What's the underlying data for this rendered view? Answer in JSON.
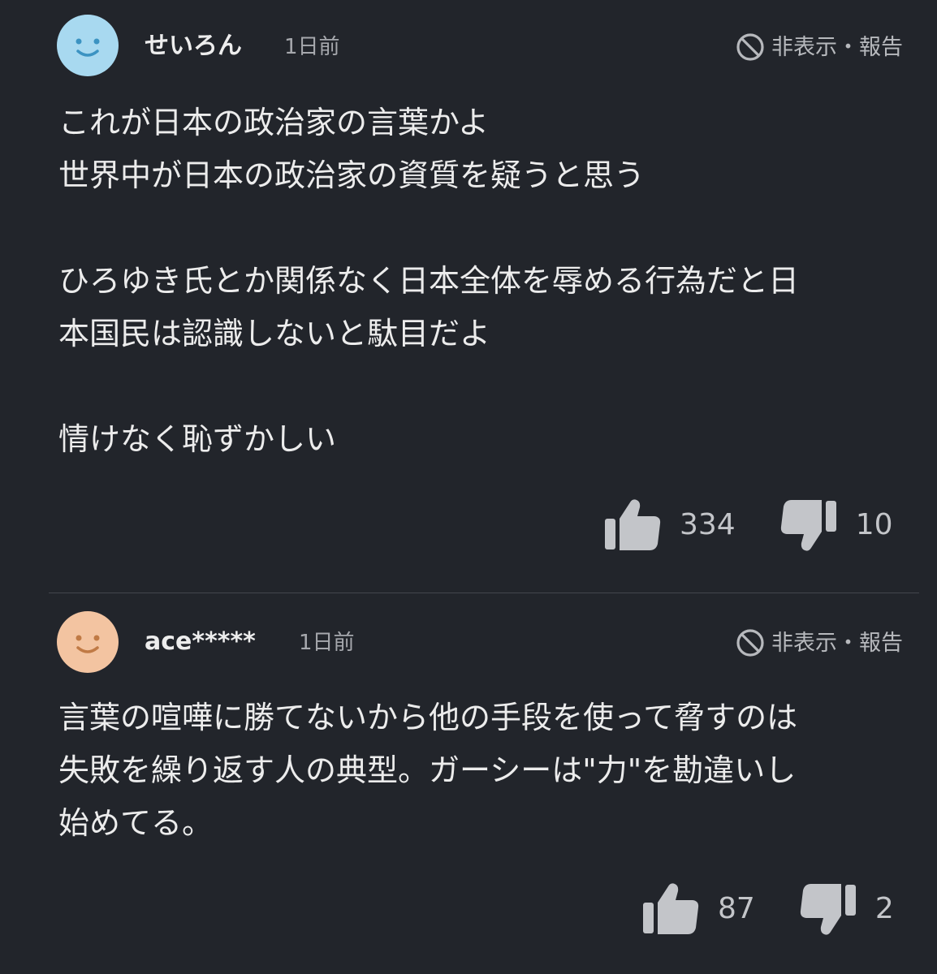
{
  "colors": {
    "background": "#22252b",
    "avatar_blue": "#a8d9f0",
    "avatar_peach": "#f3c4a1"
  },
  "comments": [
    {
      "username": "せいろん",
      "timestamp": "1日前",
      "avatar_icon": "smiley-face-icon",
      "hide_report": "非表示・報告",
      "body": "これが日本の政治家の言葉かよ\n世界中が日本の政治家の資質を疑うと思う\n\nひろゆき氏とか関係なく日本全体を辱める行為だと日\n本国民は認識しないと駄目だよ\n\n情けなく恥ずかしい",
      "likes": "334",
      "dislikes": "10"
    },
    {
      "username": "ace*****",
      "timestamp": "1日前",
      "avatar_icon": "smiley-face-icon",
      "hide_report": "非表示・報告",
      "body": "言葉の喧嘩に勝てないから他の手段を使って脅すのは\n失敗を繰り返す人の典型。ガーシーは\"力\"を勘違いし\n始めてる。",
      "likes": "87",
      "dislikes": "2"
    }
  ]
}
